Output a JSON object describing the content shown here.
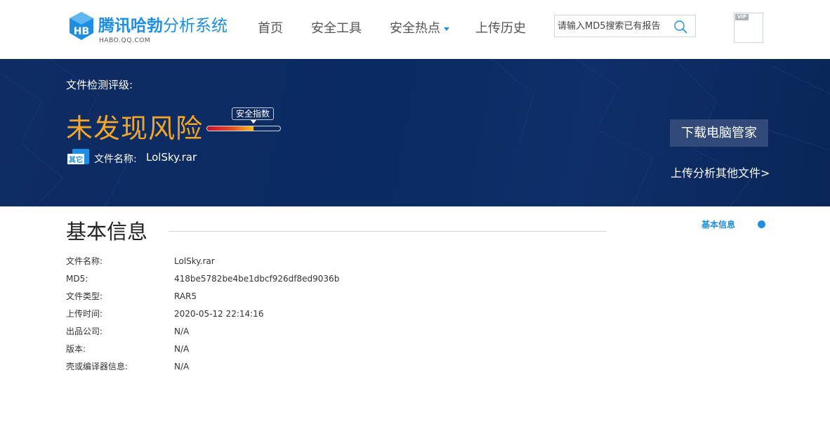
{
  "header": {
    "logo_title_strong": "腾讯哈勃",
    "logo_title_rest": "分析系统",
    "logo_sub": "HABO.QQ.COM",
    "nav": [
      {
        "label": "首页"
      },
      {
        "label": "安全工具"
      },
      {
        "label": "安全热点",
        "has_dropdown": true
      },
      {
        "label": "上传历史"
      }
    ],
    "search": {
      "placeholder": "请输入MD5搜索已有报告",
      "value": ""
    },
    "vip_badge": "VIP",
    "icons": {
      "search": "search-icon",
      "vip": "vip-icon",
      "dropdown": "caret-down-icon",
      "logo": "habo-logo-icon"
    }
  },
  "banner": {
    "rating_label": "文件检测评级:",
    "result": "未发现风险",
    "index_label": "安全指数",
    "index_fraction": 0.63,
    "file_icon_text": "其它",
    "file_name_label": "文件名称:",
    "file_name": "LolSky.rar",
    "download_button": "下载电脑管家",
    "upload_link": "上传分析其他文件>",
    "colors": {
      "result": "#f5a623",
      "background": "#0f2d63",
      "button": "#324a79"
    }
  },
  "basic_info": {
    "title": "基本信息",
    "side_nav_label": "基本信息",
    "rows": [
      {
        "key": "文件名称:",
        "value": "LolSky.rar"
      },
      {
        "key": "MD5:",
        "value": "418be5782be4be1dbcf926df8ed9036b"
      },
      {
        "key": "文件类型:",
        "value": "RAR5"
      },
      {
        "key": "上传时间:",
        "value": "2020-05-12 22:14:16"
      },
      {
        "key": "出品公司:",
        "value": "N/A"
      },
      {
        "key": "版本:",
        "value": "N/A"
      },
      {
        "key": "壳或编译器信息:",
        "value": "N/A"
      }
    ],
    "accent_color": "#1c8ee4"
  }
}
